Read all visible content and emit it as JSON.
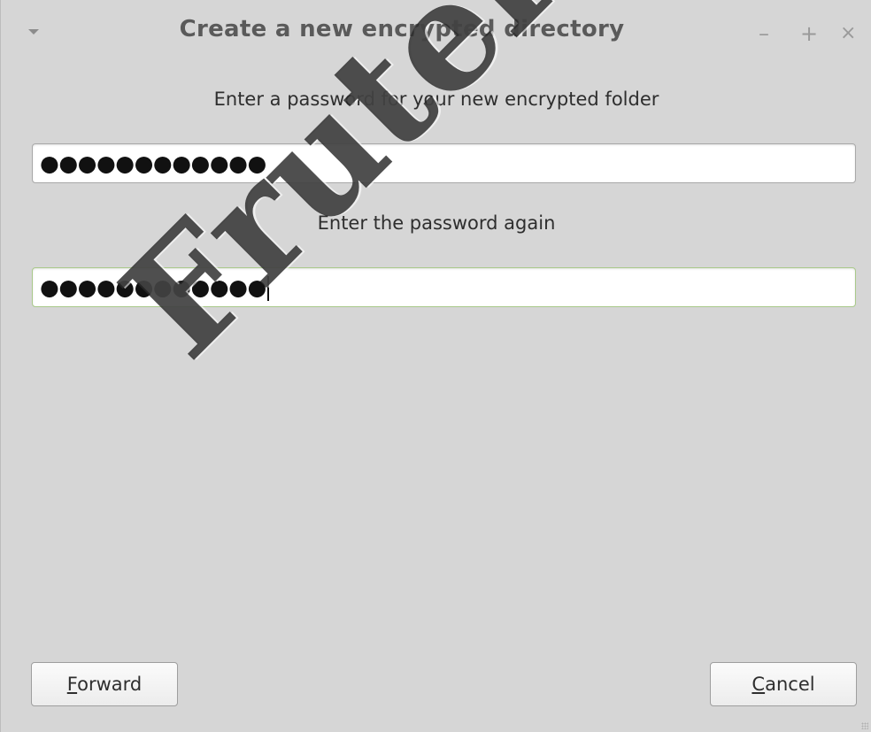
{
  "window": {
    "title": "Create a new encrypted directory",
    "controls": {
      "minimize": "–",
      "maximize": "+",
      "close": "×"
    }
  },
  "form": {
    "password_label": "Enter a password for your new encrypted folder",
    "password_value": "●●●●●●●●●●●●",
    "confirm_label": "Enter the password again",
    "confirm_value": "●●●●●●●●●●●●"
  },
  "buttons": {
    "forward_mnemonic": "F",
    "forward_rest": "orward",
    "cancel_mnemonic": "C",
    "cancel_rest": "ancel"
  },
  "watermark": {
    "text": "Fruteroloco"
  },
  "colors": {
    "window_bg": "#d6d6d6",
    "focus_border": "#a9c98a"
  }
}
